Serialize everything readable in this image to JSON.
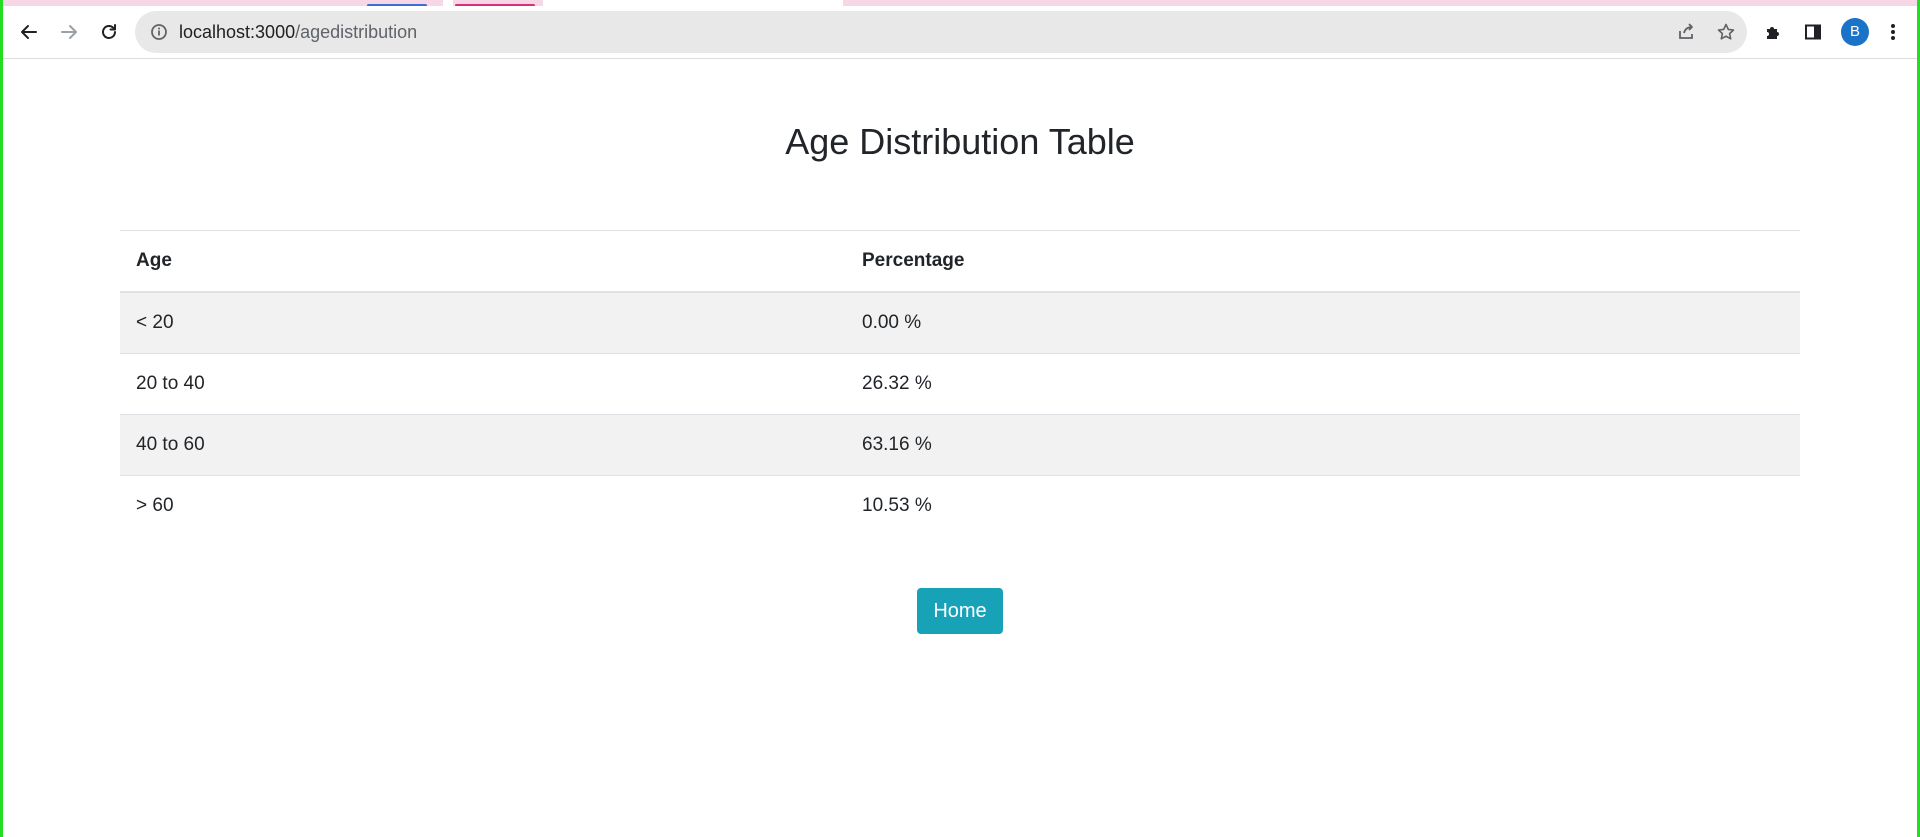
{
  "browser": {
    "url_host": "localhost:3000",
    "url_path": "/agedistribution",
    "profile_initial": "B",
    "icons": {
      "back": "arrow-left-icon",
      "forward": "arrow-right-icon",
      "reload": "reload-icon",
      "site_info": "info-circle-icon",
      "share": "share-icon",
      "bookmark": "star-icon",
      "extensions": "puzzle-icon",
      "side_panel": "side-panel-icon",
      "menu": "kebab-menu-icon"
    }
  },
  "page": {
    "title": "Age Distribution Table",
    "table": {
      "headers": [
        "Age",
        "Percentage"
      ],
      "rows": [
        {
          "age": "< 20",
          "percentage": "0.00 %"
        },
        {
          "age": "20 to 40",
          "percentage": "26.32 %"
        },
        {
          "age": "40 to 60",
          "percentage": "63.16 %"
        },
        {
          "age": "> 60",
          "percentage": "10.53 %"
        }
      ]
    },
    "home_button_label": "Home"
  },
  "colors": {
    "button": "#17a2b8",
    "stripe": "#f2f2f2",
    "avatar": "#1a73c8",
    "frame": "#22dd22"
  }
}
